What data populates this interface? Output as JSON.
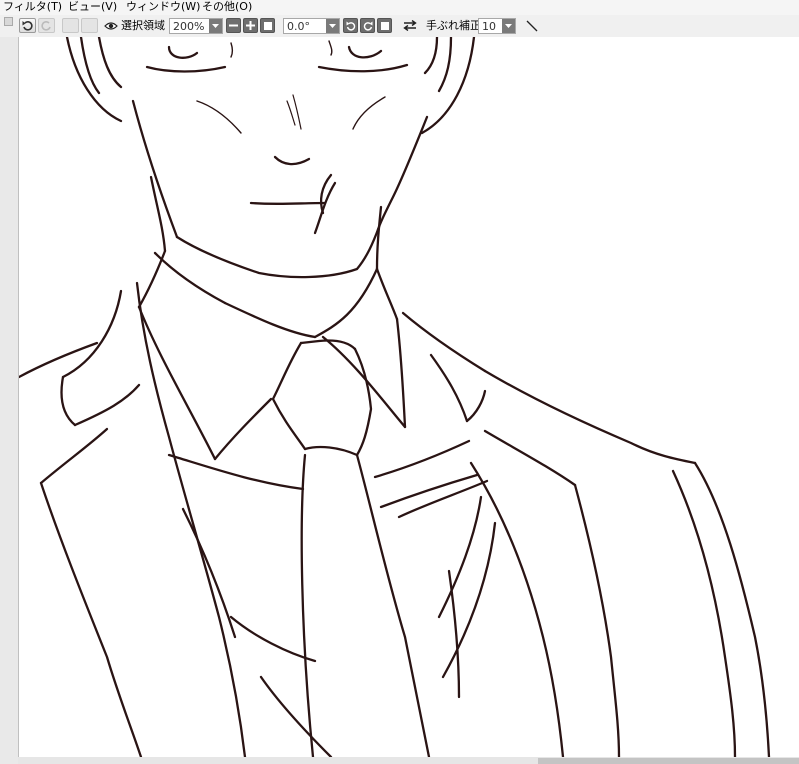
{
  "menu": [
    {
      "label": "フィルタ(T)"
    },
    {
      "label": "ビュー(V)"
    },
    {
      "label": "ウィンドウ(W)"
    },
    {
      "label": "その他(O)"
    }
  ],
  "toolbar": {
    "selection_label": "選択領域",
    "zoom_value": "200%",
    "rotation_value": "0.0°",
    "stabilizer_label": "手ぶれ補正",
    "stabilizer_value": "10"
  },
  "canvas": {
    "line_color": "#2a1414"
  }
}
